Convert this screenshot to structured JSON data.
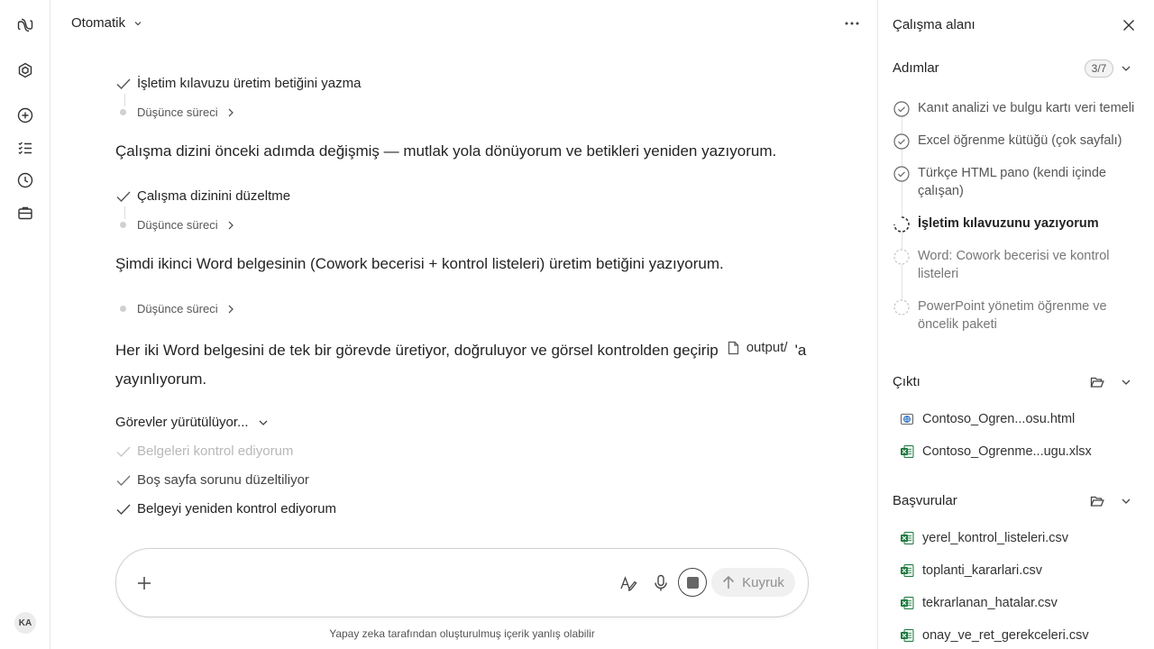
{
  "header": {
    "mode_label": "Otomatik"
  },
  "chat": {
    "step1": "İşletim kılavuzu üretim betiğini yazma",
    "thinking_label": "Düşünce süreci",
    "para1": "Çalışma dizini önceki adımda değişmiş — mutlak yola dönüyorum ve betikleri yeniden yazıyorum.",
    "step2": "Çalışma dizinini düzeltme",
    "para2": "Şimdi ikinci Word belgesinin (Cowork becerisi + kontrol listeleri) üretim betiğini yazıyorum.",
    "para3_before": "Her iki Word belgesini de tek bir görevde üretiyor, doğruluyor ve görsel kontrolden geçirip",
    "para3_chip": "output/",
    "para3_after": "'a yayınlıyorum.",
    "running_label": "Görevler yürütülüyor...",
    "tasks": [
      "Belgeleri kontrol ediyorum",
      "Boş sayfa sorunu düzeltiliyor",
      "Belgeyi yeniden kontrol ediyorum"
    ]
  },
  "composer": {
    "placeholder": "",
    "send_label": "Kuyruk",
    "disclaimer": "Yapay zeka tarafından oluşturulmuş içerik yanlış olabilir"
  },
  "user": {
    "initials": "KA"
  },
  "panel": {
    "title": "Çalışma alanı",
    "steps_label": "Adımlar",
    "steps_badge": "3/7",
    "steps": [
      {
        "label": "Kanıt analizi ve bulgu kartı veri temeli",
        "status": "done"
      },
      {
        "label": "Excel öğrenme kütüğü (çok sayfalı)",
        "status": "done"
      },
      {
        "label": "Türkçe HTML pano (kendi içinde çalışan)",
        "status": "done"
      },
      {
        "label": "İşletim kılavuzunu yazıyorum",
        "status": "active"
      },
      {
        "label": "Word: Cowork becerisi ve kontrol listeleri",
        "status": "pending"
      },
      {
        "label": "PowerPoint yönetim öğrenme ve öncelik paketi",
        "status": "pending"
      }
    ],
    "output_label": "Çıktı",
    "outputs": [
      {
        "name": "Contoso_Ogren...osu.html",
        "type": "html"
      },
      {
        "name": "Contoso_Ogrenme...ugu.xlsx",
        "type": "excel"
      }
    ],
    "refs_label": "Başvurular",
    "refs": [
      {
        "name": "yerel_kontrol_listeleri.csv"
      },
      {
        "name": "toplanti_kararlari.csv"
      },
      {
        "name": "tekrarlanan_hatalar.csv"
      },
      {
        "name": "onay_ve_ret_gerekceleri.csv"
      }
    ]
  },
  "colors": {
    "excel_green": "#1f7a3f",
    "muted": "#b8b8b8"
  }
}
